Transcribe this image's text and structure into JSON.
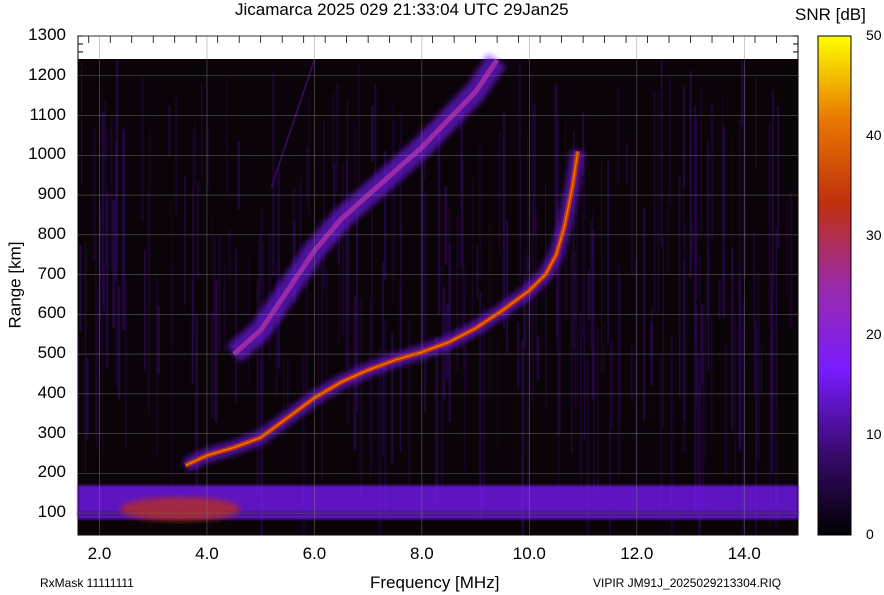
{
  "header": {
    "title": "Jicamarca 2025 029 21:33:04 UTC       29Jan25",
    "colorbar_title": "SNR [dB]"
  },
  "footer": {
    "rxmask": "RxMask 11111111",
    "file": "VIPIR  JM91J_2025029213304.RIQ"
  },
  "chart_data": {
    "type": "heatmap",
    "title": "Jicamarca 2025 029 21:33:04 UTC       29Jan25",
    "xlabel": "Frequency [MHz]",
    "ylabel": "Range [km]",
    "xlim": [
      1.6,
      15.0
    ],
    "ylim": [
      45,
      1300
    ],
    "data_top_km": 1240,
    "xticks": [
      "2.0",
      "4.0",
      "6.0",
      "8.0",
      "10.0",
      "12.0",
      "14.0"
    ],
    "xtick_values": [
      2,
      4,
      6,
      8,
      10,
      12,
      14
    ],
    "yticks": [
      "100",
      "200",
      "300",
      "400",
      "500",
      "600",
      "700",
      "800",
      "900",
      "1000",
      "1100",
      "1200",
      "1300"
    ],
    "ytick_values": [
      100,
      200,
      300,
      400,
      500,
      600,
      700,
      800,
      900,
      1000,
      1100,
      1200,
      1300
    ],
    "grid": true,
    "colorbar": {
      "label": "SNR [dB]",
      "range": [
        0,
        50
      ],
      "ticks": [
        "0",
        "10",
        "20",
        "30",
        "40",
        "50"
      ],
      "tick_values": [
        0,
        10,
        20,
        30,
        40,
        50
      ],
      "colors": [
        "#000000",
        "#3a0a70",
        "#7a1cff",
        "#9a2aa8",
        "#c0300c",
        "#e87800",
        "#ffff00"
      ]
    },
    "traces": [
      {
        "name": "F-layer echo",
        "peak_snr": 45,
        "points": [
          [
            3.6,
            220
          ],
          [
            4.0,
            245
          ],
          [
            4.5,
            265
          ],
          [
            5.0,
            290
          ],
          [
            5.5,
            340
          ],
          [
            6.0,
            390
          ],
          [
            6.5,
            430
          ],
          [
            7.0,
            460
          ],
          [
            7.5,
            485
          ],
          [
            8.0,
            505
          ],
          [
            8.5,
            530
          ],
          [
            9.0,
            565
          ],
          [
            9.5,
            610
          ],
          [
            10.0,
            660
          ],
          [
            10.3,
            700
          ],
          [
            10.5,
            750
          ],
          [
            10.65,
            820
          ],
          [
            10.8,
            920
          ],
          [
            10.9,
            1010
          ]
        ]
      },
      {
        "name": "F-layer second hop",
        "peak_snr": 28,
        "points": [
          [
            4.5,
            500
          ],
          [
            5.0,
            560
          ],
          [
            5.5,
            660
          ],
          [
            6.0,
            760
          ],
          [
            6.5,
            840
          ],
          [
            7.0,
            900
          ],
          [
            7.5,
            960
          ],
          [
            8.0,
            1020
          ],
          [
            8.5,
            1090
          ],
          [
            9.0,
            1160
          ],
          [
            9.4,
            1240
          ]
        ]
      },
      {
        "name": "faint oblique line",
        "peak_snr": 12,
        "points": [
          [
            5.2,
            920
          ],
          [
            6.0,
            1240
          ]
        ]
      }
    ],
    "bands": [
      {
        "name": "E-region / low-range echoes",
        "range_km": [
          85,
          170
        ],
        "freq_mhz": [
          1.6,
          15.0
        ],
        "peak_snr": 32
      },
      {
        "name": "100 km ground line",
        "range_km": [
          95,
          105
        ],
        "freq_mhz": [
          1.6,
          15.0
        ],
        "peak_snr": 20
      }
    ]
  }
}
